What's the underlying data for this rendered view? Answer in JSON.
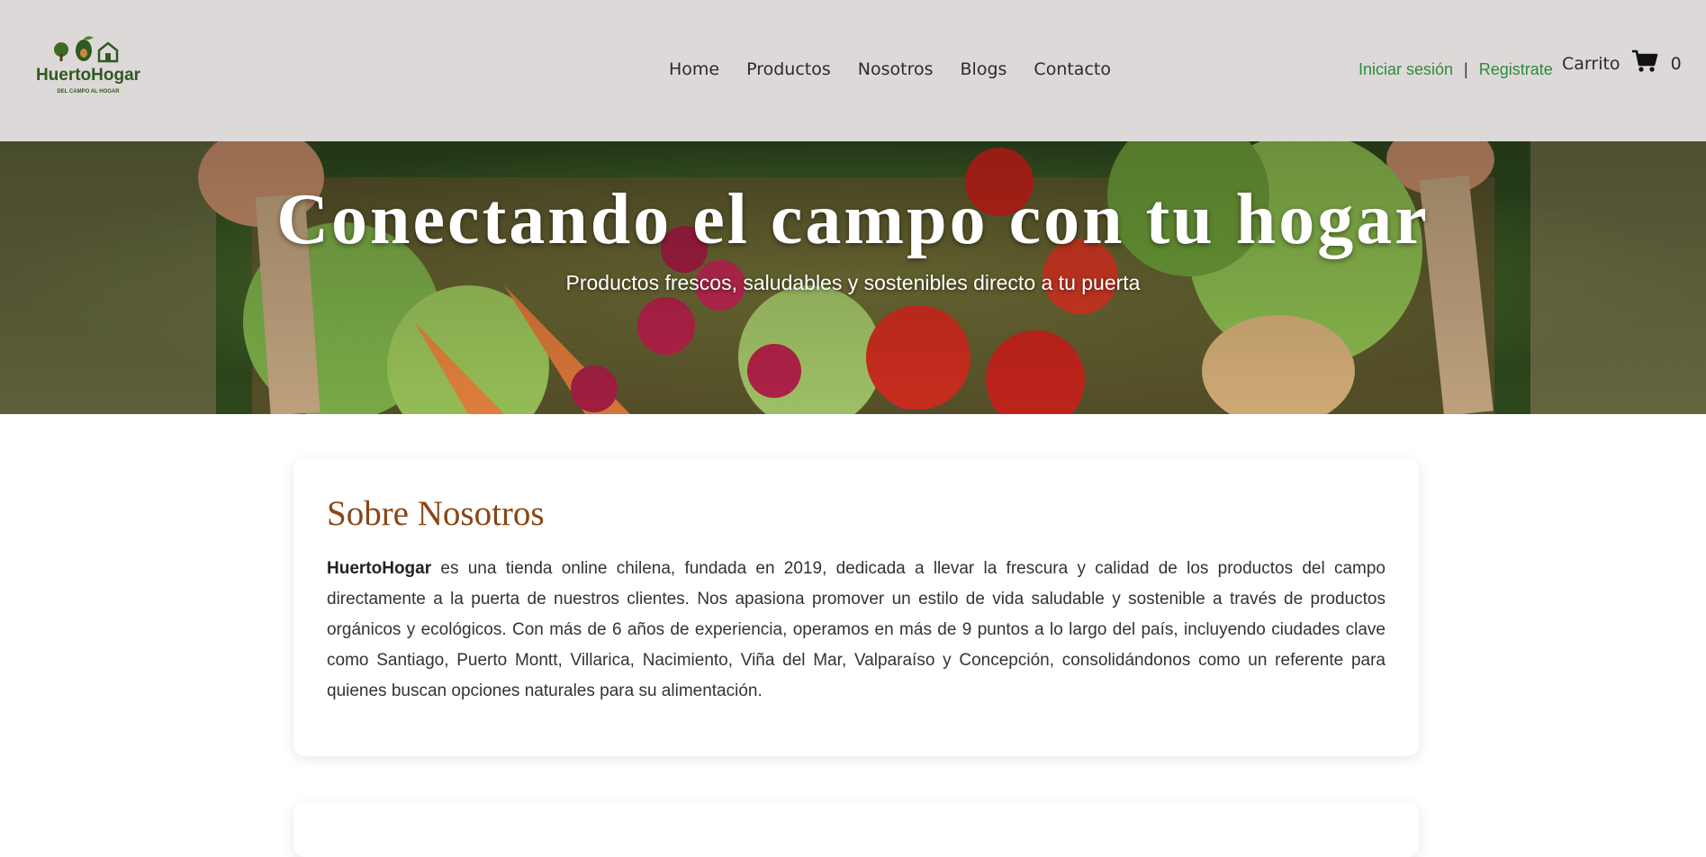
{
  "header": {
    "brand": {
      "name": "HuertoHogar",
      "tagline": "DEL CAMPO AL HOGAR",
      "color": "#2f5a1f"
    },
    "nav": [
      {
        "label": "Home"
      },
      {
        "label": "Productos"
      },
      {
        "label": "Nosotros"
      },
      {
        "label": "Blogs"
      },
      {
        "label": "Contacto"
      }
    ],
    "auth": {
      "login_label": "Iniciar sesión",
      "separator": "|",
      "register_label": "Registrate",
      "color": "#2e8b3e"
    },
    "cart": {
      "label": "Carrito",
      "icon": "cart-icon",
      "count": "0"
    }
  },
  "hero": {
    "title": "Conectando el campo con tu hogar",
    "subtitle": "Productos frescos, saludables y sostenibles directo a tu puerta"
  },
  "about": {
    "title": "Sobre Nosotros",
    "brand_bold": "HuertoHogar",
    "body": " es una tienda online chilena, fundada en 2019, dedicada a llevar la frescura y calidad de los productos del campo directamente a la puerta de nuestros clientes. Nos apasiona promover un estilo de vida saludable y sostenible a través de productos orgánicos y ecológicos. Con más de 6 años de experiencia, operamos en más de 9 puntos a lo largo del país, incluyendo ciudades clave como Santiago, Puerto Montt, Villarica, Nacimiento, Viña del Mar, Valparaíso y Concepción, consolidándonos como un referente para quienes buscan opciones naturales para su alimentación.",
    "title_color": "#8b4513"
  }
}
